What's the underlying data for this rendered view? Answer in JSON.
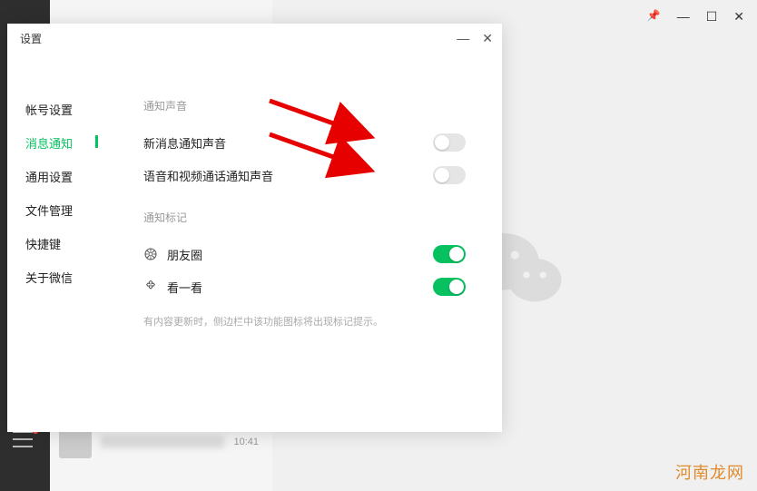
{
  "window": {
    "pin": "📌",
    "controls": {
      "min": "—",
      "max": "☐",
      "close": "✕"
    }
  },
  "dialog": {
    "title": "设置",
    "controls": {
      "min": "—",
      "close": "✕"
    },
    "nav": [
      {
        "label": "帐号设置",
        "active": false
      },
      {
        "label": "消息通知",
        "active": true
      },
      {
        "label": "通用设置",
        "active": false
      },
      {
        "label": "文件管理",
        "active": false
      },
      {
        "label": "快捷键",
        "active": false
      },
      {
        "label": "关于微信",
        "active": false
      }
    ],
    "sections": {
      "sound": {
        "heading": "通知声音",
        "items": [
          {
            "label": "新消息通知声音",
            "on": false
          },
          {
            "label": "语音和视频通话通知声音",
            "on": false
          }
        ]
      },
      "badge": {
        "heading": "通知标记",
        "items": [
          {
            "icon": "moments",
            "label": "朋友圈",
            "on": true
          },
          {
            "icon": "topstories",
            "label": "看一看",
            "on": true
          }
        ],
        "hint": "有内容更新时，侧边栏中该功能图标将出现标记提示。"
      }
    }
  },
  "chat": {
    "time": "10:41"
  },
  "watermark": "河南龙网"
}
